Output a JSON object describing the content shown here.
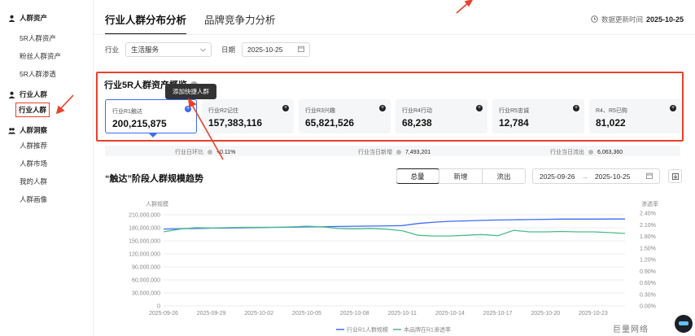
{
  "sidebar": {
    "sections": [
      {
        "title": "人群资产",
        "items": [
          "5R人群资产",
          "粉丝人群资产",
          "5R人群渗透"
        ]
      },
      {
        "title": "行业人群",
        "items": [
          "行业人群"
        ]
      },
      {
        "title": "人群洞察",
        "items": [
          "人群推荐",
          "人群市场",
          "我的人群",
          "人群画像"
        ]
      }
    ],
    "active_item": "行业人群"
  },
  "tabs": [
    "行业人群分布分析",
    "品牌竞争力分析"
  ],
  "update": {
    "label": "数据更新时间",
    "value": "2025-10-25"
  },
  "filters": {
    "industry_label": "行业",
    "industry_value": "生活服务",
    "date_label": "日期",
    "date_value": "2025-10-25"
  },
  "overview": {
    "title": "行业5R人群资产概览",
    "tooltip": "添加快捷人群",
    "cards": [
      {
        "label": "行业R1触达",
        "value": "200,215,875"
      },
      {
        "label": "行业R2记住",
        "value": "157,383,116"
      },
      {
        "label": "行业R3兴趣",
        "value": "65,821,526"
      },
      {
        "label": "行业R4行动",
        "value": "68,238"
      },
      {
        "label": "行业R5忠诚",
        "value": "12,784"
      },
      {
        "label": "R4、R5已购",
        "value": "81,022"
      }
    ]
  },
  "stats": [
    {
      "label": "行业日环比",
      "value": "+0.11%"
    },
    {
      "label": "行业当日新增",
      "value": "7,493,201"
    },
    {
      "label": "行业当日流出",
      "value": "6,063,360"
    }
  ],
  "trend": {
    "title": "“触达”阶段人群规模趋势",
    "segments": [
      "总量",
      "新增",
      "流出"
    ],
    "active_segment": "总量",
    "range_start": "2025-09-26",
    "range_end": "2025-10-25",
    "range_sep": "→"
  },
  "colors": {
    "accent": "#3b6cf5",
    "highlight": "#e8412c",
    "series1": "#3b6cf5",
    "series2": "#4dbb8a"
  },
  "chart_data": {
    "type": "line",
    "ylabel": "人群规模",
    "y2label": "渗透率",
    "ylim": [
      0,
      210000000
    ],
    "y2lim": [
      0,
      2.4
    ],
    "y_ticks": [
      "210,000,000",
      "180,000,000",
      "150,000,000",
      "120,000,000",
      "90,000,000",
      "60,000,000",
      "30,000,000",
      "0"
    ],
    "y2_ticks": [
      "2.40%",
      "2.10%",
      "1.80%",
      "1.50%",
      "1.20%",
      "0.90%",
      "0.60%",
      "0.30%",
      "0.00%"
    ],
    "x_tick_labels": [
      "2025-09-26",
      "2025-09-29",
      "2025-10-02",
      "2025-10-05",
      "2025-10-08",
      "2025-10-11",
      "2025-10-14",
      "2025-10-17",
      "2025-10-20",
      "2025-10-23"
    ],
    "x": [
      "2025-09-26",
      "2025-09-27",
      "2025-09-28",
      "2025-09-29",
      "2025-09-30",
      "2025-10-01",
      "2025-10-02",
      "2025-10-03",
      "2025-10-04",
      "2025-10-05",
      "2025-10-06",
      "2025-10-07",
      "2025-10-08",
      "2025-10-09",
      "2025-10-10",
      "2025-10-11",
      "2025-10-12",
      "2025-10-13",
      "2025-10-14",
      "2025-10-15",
      "2025-10-16",
      "2025-10-17",
      "2025-10-18",
      "2025-10-19",
      "2025-10-20",
      "2025-10-21",
      "2025-10-22",
      "2025-10-23",
      "2025-10-24",
      "2025-10-25"
    ],
    "series": [
      {
        "name": "行业R1人群规模",
        "axis": "left",
        "values": [
          177000000,
          178000000,
          178500000,
          179000000,
          179500000,
          180000000,
          180500000,
          181000000,
          181500000,
          182000000,
          182500000,
          183000000,
          183500000,
          184000000,
          184500000,
          185000000,
          190000000,
          193000000,
          195000000,
          196000000,
          197000000,
          198000000,
          198500000,
          199000000,
          199500000,
          200000000,
          200000000,
          200000000,
          200200000,
          200215875
        ]
      },
      {
        "name": "本品牌在R1渗透率",
        "axis": "right",
        "values": [
          1.95,
          2.02,
          2.06,
          2.05,
          2.06,
          2.07,
          2.07,
          2.07,
          2.08,
          2.1,
          2.08,
          2.04,
          2.03,
          2.04,
          2.02,
          1.98,
          1.86,
          1.84,
          1.84,
          1.86,
          1.88,
          1.85,
          1.99,
          1.95,
          1.95,
          1.96,
          1.95,
          1.95,
          1.93,
          1.91
        ]
      }
    ]
  }
}
